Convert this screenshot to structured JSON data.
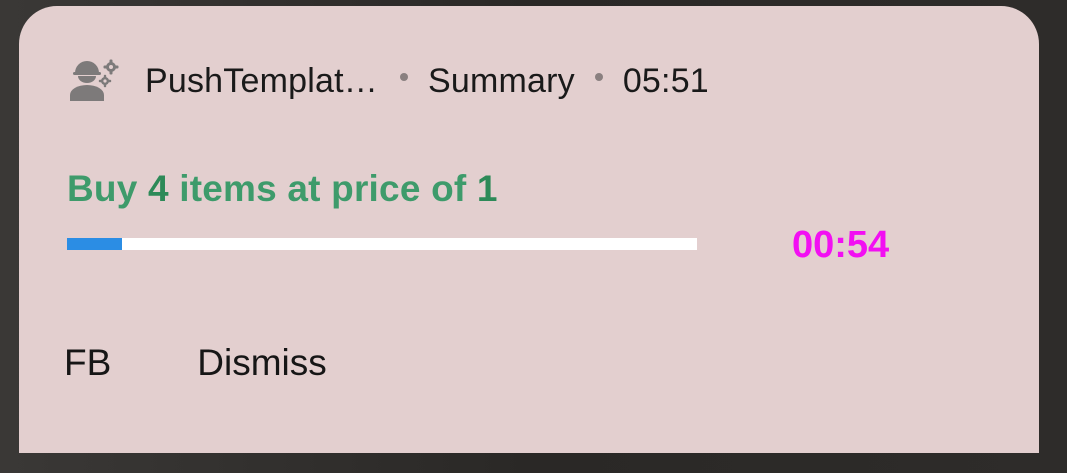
{
  "notification": {
    "app_icon": "worker-gears-icon",
    "app_name": "PushTemplat…",
    "summary": "Summary",
    "time": "05:51",
    "title_prefix": "Buy ",
    "title_qty": "4",
    "title_middle": " items at price of ",
    "title_price": "1",
    "timer": "00:54",
    "progress_fraction": 0.087,
    "actions": [
      {
        "label": "FB"
      },
      {
        "label": "Dismiss"
      }
    ]
  },
  "colors": {
    "card_background": "#e3cfcf",
    "title": "#3e9b6b",
    "timer": "#f20ff2",
    "progress_fill": "#2b8de4",
    "progress_track": "#ffffff"
  }
}
